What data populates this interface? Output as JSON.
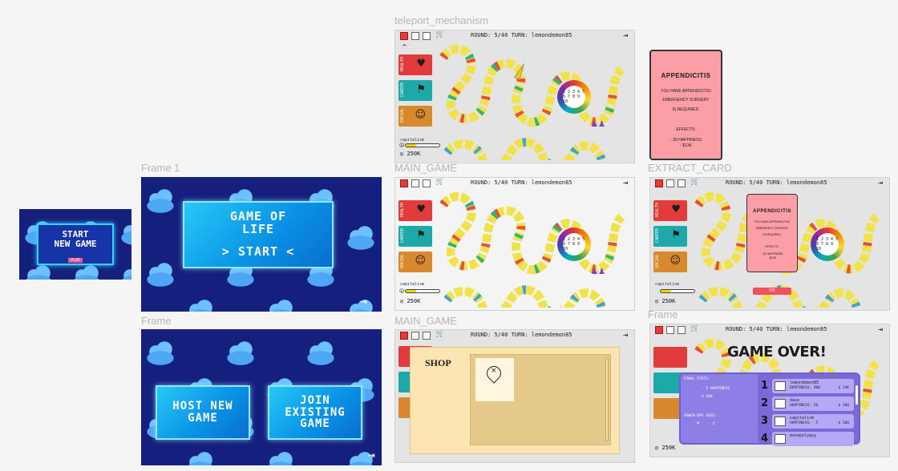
{
  "frames": {
    "teleport_mechanism": "teleport_mechanism",
    "frame_1": "Frame 1",
    "main_game_1": "MAIN_GAME",
    "extract_card": "EXTRACT_CARD",
    "frame_2": "Frame",
    "main_game_2": "MAIN_GAME",
    "frame_3": "Frame"
  },
  "start_thumb": {
    "line1": "START",
    "line2": "NEW GAME",
    "play": "PLAY"
  },
  "title_screen": {
    "line1": "GAME OF",
    "line2": "LIFE",
    "start": "> START <"
  },
  "lobby": {
    "host": "HOST NEW GAME",
    "join": "JOIN EXISTING GAME"
  },
  "board": {
    "round_text": "ROUND: 5/40 TURN: lemondemon85",
    "cards": [
      {
        "label": "HEALTH",
        "icon": "heart"
      },
      {
        "label": "CAREER",
        "icon": "runner"
      },
      {
        "label": "SOCIAL",
        "icon": "people"
      }
    ],
    "player": "capitalism",
    "money": "250K",
    "happiness_fraction": 0.3,
    "spinner_numbers": "1 2 3 4 5 6 7 8 9 10"
  },
  "appendicitis_card": {
    "title": "APPENDICITIS",
    "line1": "YOU HAVE APPENDICITIS!",
    "line2": "EMERGENCY SURGERY",
    "line3": "IS REQUIRED.",
    "effects_label": "EFFECTS:",
    "effect1": "- 30 HAPPINESS",
    "effect2": "- $13K",
    "ok": "OK"
  },
  "shop": {
    "title": "SHOP"
  },
  "game_over": {
    "title": "GAME OVER!",
    "final_stats_label": "FINAL STATS:",
    "stat_happiness": "- 5 HAPPINESS",
    "stat_money": "$ 500",
    "powerups_label": "POWER-UPS USED:",
    "powerups_count": "- 3",
    "leaderboard": [
      {
        "rank": "1",
        "name": "lemondemon85",
        "stat": "HAPPINESS: 400",
        "money": "$ 14K"
      },
      {
        "rank": "2",
        "name": "dave",
        "stat": "HAPPINESS: 50",
        "money": "$ 100"
      },
      {
        "rank": "3",
        "name": "capitalism",
        "stat": "HAPPINESS: -5",
        "money": "$ 500"
      },
      {
        "rank": "4",
        "name": "monopolyguy",
        "stat": "",
        "money": ""
      }
    ]
  },
  "colors": {
    "navy": "#15207e",
    "cyan": "#0a93e6",
    "card_pink": "#fb9ea6",
    "shop": "#fbe6b3",
    "panel": "#8e7fe6"
  }
}
